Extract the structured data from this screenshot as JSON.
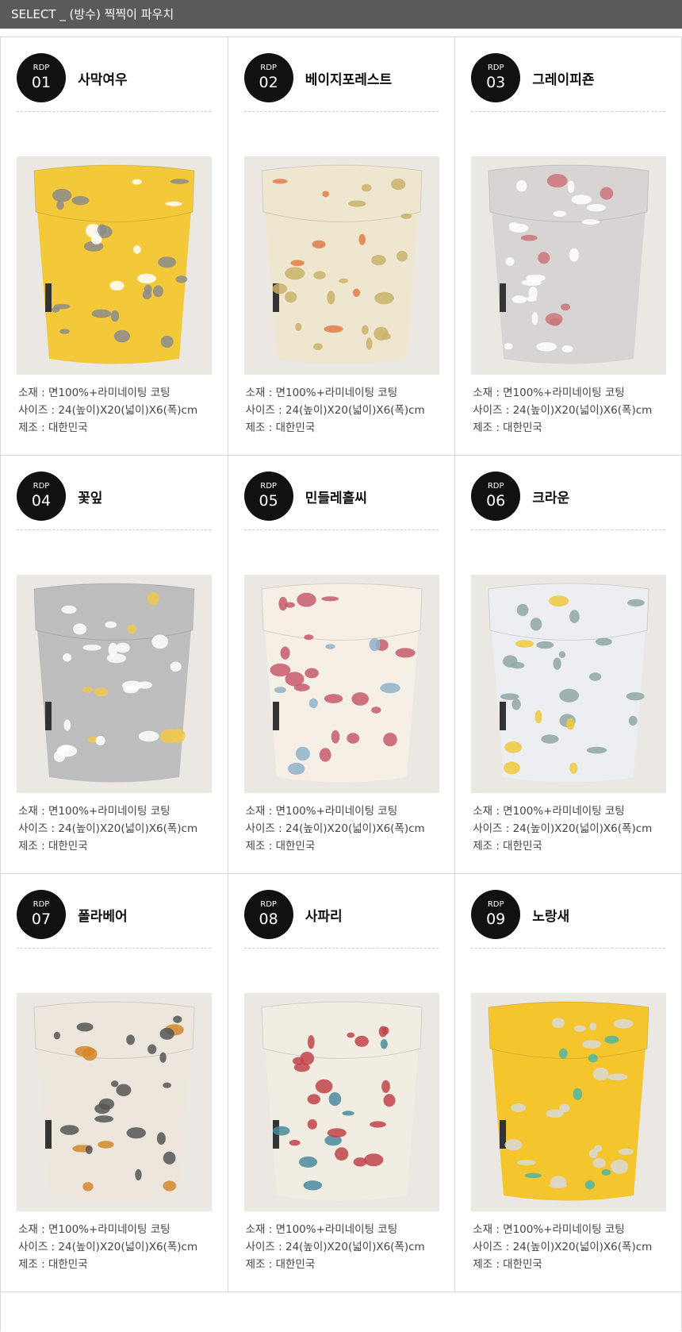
{
  "header": {
    "title": "SELECT _ (방수) 찍찍이 파우치"
  },
  "spec_labels": {
    "material": "소재 : 면100%+라미네이팅 코팅",
    "size": "사이즈 : 24(높이)X20(넓이)X6(폭)cm",
    "origin": "제조 : 대한민국"
  },
  "products": [
    {
      "rdp": "RDP",
      "num": "01",
      "name": "사막여우",
      "bg": "#f3c93a",
      "fg": "#8b8b8b",
      "accent": "#ffffff"
    },
    {
      "rdp": "RDP",
      "num": "02",
      "name": "베이지포레스트",
      "bg": "#efe6cf",
      "fg": "#c9b26a",
      "accent": "#e07b4a"
    },
    {
      "rdp": "RDP",
      "num": "03",
      "name": "그레이피죤",
      "bg": "#d9d4d4",
      "fg": "#ffffff",
      "accent": "#c9767a"
    },
    {
      "rdp": "RDP",
      "num": "04",
      "name": "꽃잎",
      "bg": "#bdbdbd",
      "fg": "#ffffff",
      "accent": "#f2c94c"
    },
    {
      "rdp": "RDP",
      "num": "05",
      "name": "민들레홀씨",
      "bg": "#f5efe6",
      "fg": "#c45a6a",
      "accent": "#8fb1c9"
    },
    {
      "rdp": "RDP",
      "num": "06",
      "name": "크라운",
      "bg": "#eceef1",
      "fg": "#8fa7a5",
      "accent": "#f0c93d"
    },
    {
      "rdp": "RDP",
      "num": "07",
      "name": "폴라베어",
      "bg": "#ece6dc",
      "fg": "#555555",
      "accent": "#d4872b"
    },
    {
      "rdp": "RDP",
      "num": "08",
      "name": "사파리",
      "bg": "#f1ede3",
      "fg": "#c0434a",
      "accent": "#4a8b9c"
    },
    {
      "rdp": "RDP",
      "num": "09",
      "name": "노랑새",
      "bg": "#f5c52e",
      "fg": "#d9d9d9",
      "accent": "#4fb5a3"
    }
  ]
}
